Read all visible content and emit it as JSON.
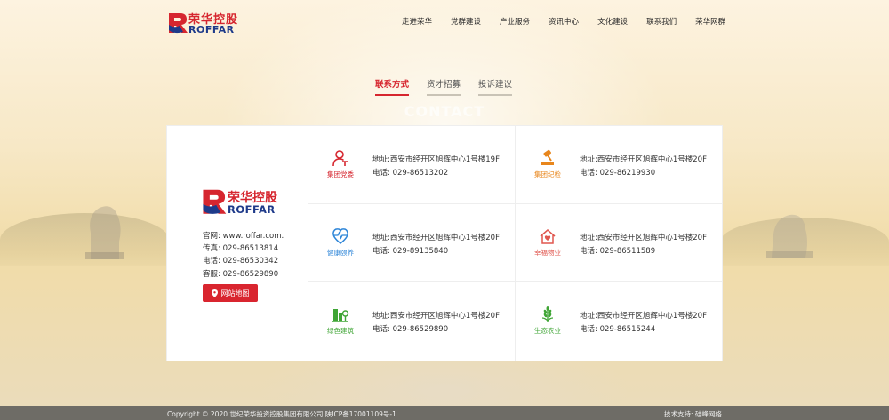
{
  "header": {
    "logo_cn": "荣华控股",
    "logo_en": "ROFFAR",
    "nav": [
      "走进荣华",
      "党群建设",
      "产业服务",
      "资讯中心",
      "文化建设",
      "联系我们",
      "荣华网群"
    ]
  },
  "tabs": [
    "联系方式",
    "资才招募",
    "投诉建议"
  ],
  "section_title": "CONTACT",
  "company": {
    "logo_cn": "荣华控股",
    "logo_en": "ROFFAR",
    "website": "官网:  www.roffar.com.",
    "fax": "传真:  029-86513814",
    "phone": "电话:  029-86530342",
    "service": "客服:  029-86529890",
    "map_button": "网站地图"
  },
  "contacts": [
    {
      "name": "集团党委",
      "color": "#d6262f",
      "icon": "party-icon",
      "address": "地址:西安市经开区旭辉中心1号楼19F",
      "phone": "电话: 029-86513202"
    },
    {
      "name": "集团纪检",
      "color": "#e8861c",
      "icon": "gavel-icon",
      "address": "地址:西安市经开区旭辉中心1号楼20F",
      "phone": "电话: 029-86219930"
    },
    {
      "name": "健康颐养",
      "color": "#2f86d8",
      "icon": "heart-pulse-icon",
      "address": "地址:西安市经开区旭辉中心1号楼20F",
      "phone": "电话: 029-89135840"
    },
    {
      "name": "幸福物业",
      "color": "#e0574f",
      "icon": "home-heart-icon",
      "address": "地址:西安市经开区旭辉中心1号楼20F",
      "phone": "电话: 029-86511589"
    },
    {
      "name": "绿色建筑",
      "color": "#3fa535",
      "icon": "building-tree-icon",
      "address": "地址:西安市经开区旭辉中心1号楼20F",
      "phone": "电话: 029-86529890"
    },
    {
      "name": "生态农业",
      "color": "#3fa535",
      "icon": "wheat-icon",
      "address": "地址:西安市经开区旭辉中心1号楼20F",
      "phone": "电话: 029-86515244"
    }
  ],
  "footer": {
    "copyright": "Copyright © 2020 世纪荣华投资控股集团有限公司 陕ICP备17001109号-1",
    "support": "技术支持:  硅峰网络"
  }
}
